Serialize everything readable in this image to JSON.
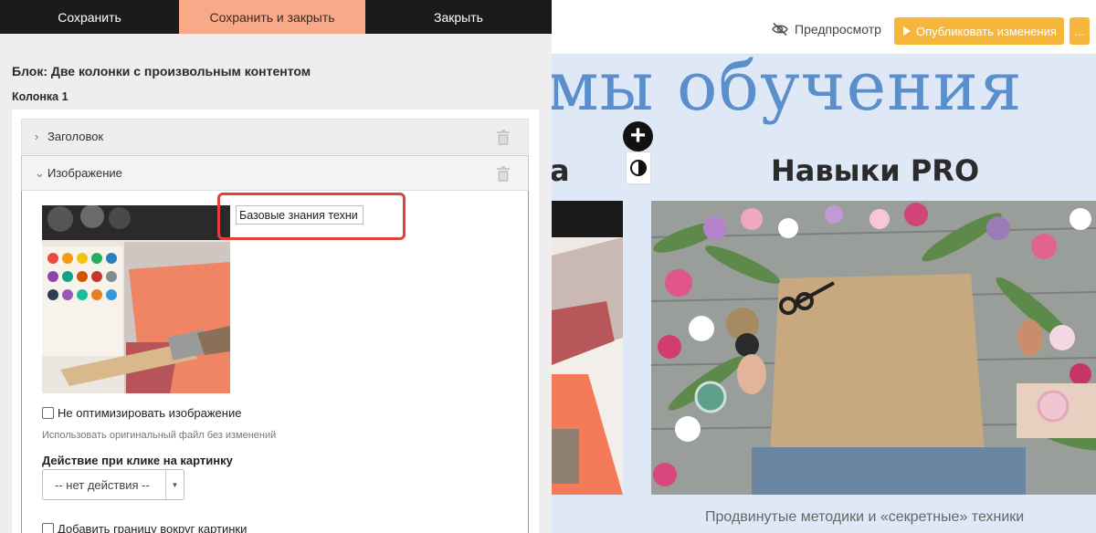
{
  "toolbar": {
    "save_label": "Сохранить",
    "save_close_label": "Сохранить и закрыть",
    "close_label": "Закрыть"
  },
  "editor": {
    "block_title": "Блок: Две колонки с произвольным контентом",
    "column_title": "Колонка 1",
    "sections": [
      {
        "label": "Заголовок",
        "expanded": false
      },
      {
        "label": "Изображение",
        "expanded": true
      }
    ],
    "image_alt_value": "Базовые знания техни",
    "no_optimize_label": "Не оптимизировать изображение",
    "no_optimize_hint": "Использовать оригинальный файл без изменений",
    "click_action_label": "Действие при клике на картинку",
    "click_action_value": "-- нет действия --",
    "border_label": "Добавить границу вокруг картинки"
  },
  "preview": {
    "preview_label": "Предпросмотр",
    "publish_label": "Опубликовать изменения",
    "more_label": "...",
    "big_heading": "мы обучения",
    "left_col_heading_fragment": "а",
    "col_heading": "Навыки PRO",
    "caption": "Продвинутые методики и «секретные» техники"
  },
  "icons": {
    "eye": "eye-slash-icon",
    "play": "play-icon",
    "add": "plus-circle-icon",
    "contrast": "contrast-icon",
    "trash": "trash-icon",
    "chevron_right": "chevron-right-icon",
    "chevron_down": "chevron-down-icon"
  },
  "colors": {
    "toolbar_bg": "#1b1b1b",
    "accent_salmon": "#f7a988",
    "publish_orange": "#f5b63b",
    "heading_blue": "#5a8fcc",
    "highlight_red": "#e0413a",
    "preview_bg": "#dfe8f6"
  }
}
